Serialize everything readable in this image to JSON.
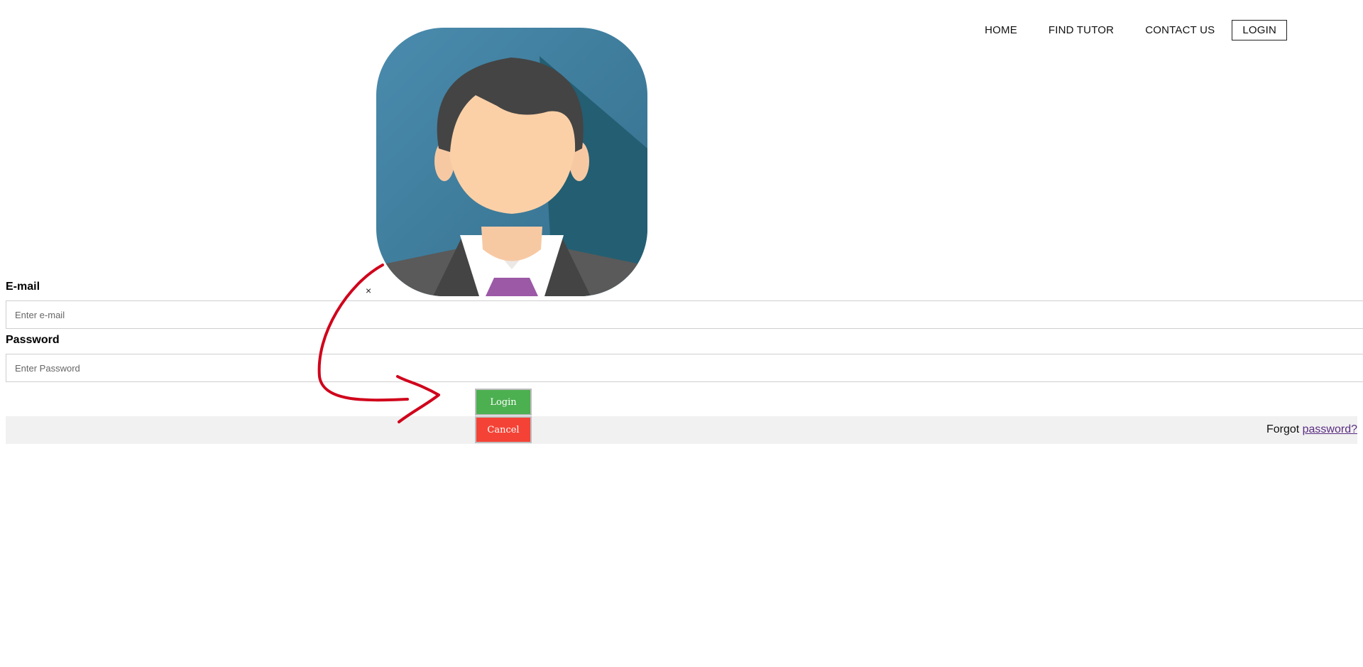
{
  "nav": {
    "items": [
      {
        "label": "HOME"
      },
      {
        "label": "FIND TUTOR"
      },
      {
        "label": "CONTACT US"
      },
      {
        "label": "LOGIN"
      }
    ]
  },
  "modal": {
    "close_label": "×",
    "email": {
      "label": "E-mail",
      "placeholder": "Enter e-mail",
      "value": ""
    },
    "password": {
      "label": "Password",
      "placeholder": "Enter Password",
      "value": ""
    },
    "login_button": "Login",
    "cancel_button": "Cancel",
    "forgot_prefix": "Forgot ",
    "forgot_link": "password?"
  },
  "colors": {
    "login_button": "#4caf50",
    "cancel_button": "#f44336",
    "footer_bar": "#f1f1f1",
    "avatar_bg": "#3f7d9b",
    "annotation_arrow": "#d0021b"
  }
}
